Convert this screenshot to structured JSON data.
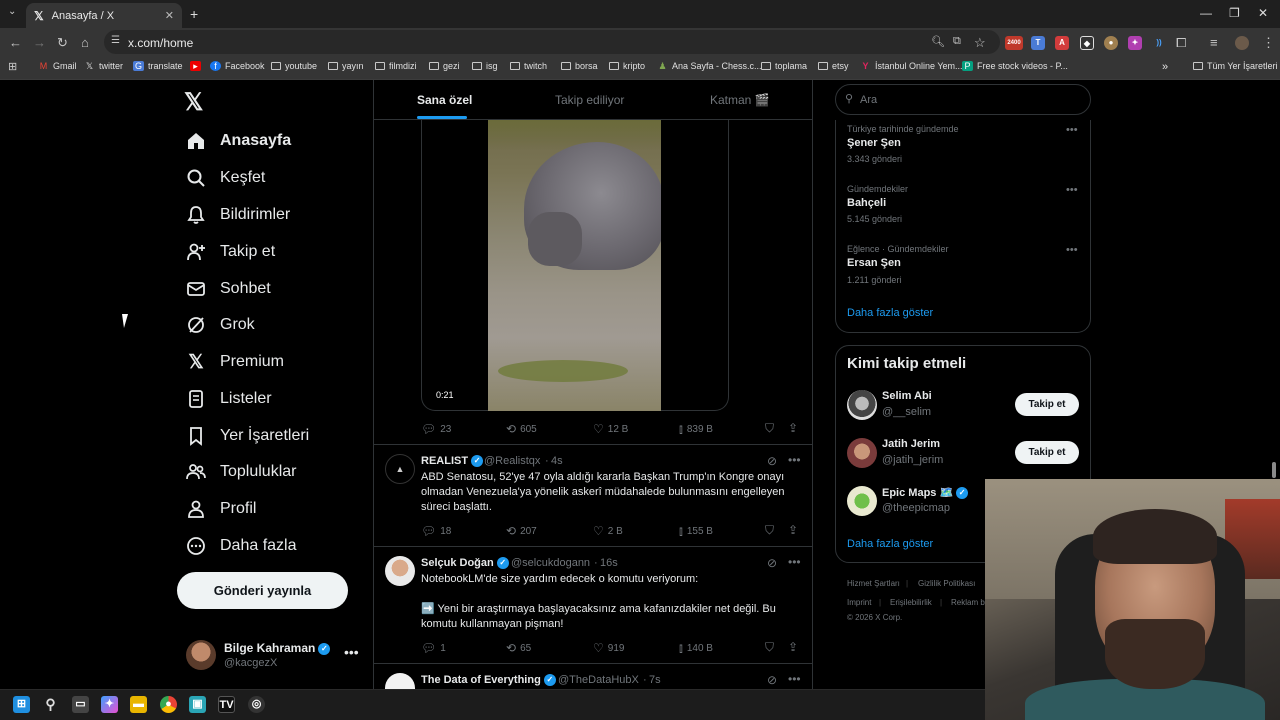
{
  "browser": {
    "tab_title": "Anasayfa / X",
    "url": "x.com/home",
    "bookmarks": [
      "Gmail",
      "twitter",
      "translate",
      "Facebook",
      "youtube",
      "yayın",
      "filmdizi",
      "gezi",
      "isg",
      "twitch",
      "borsa",
      "kripto",
      "Ana Sayfa - Chess.c...",
      "toplama",
      "etsy",
      "İstanbul Online Yem...",
      "Free stock videos - P...",
      "Tüm Yer İşaretleri"
    ],
    "ext_badge": "2400"
  },
  "nav": {
    "items": [
      "Anasayfa",
      "Keşfet",
      "Bildirimler",
      "Takip et",
      "Sohbet",
      "Grok",
      "Premium",
      "Listeler",
      "Yer İşaretleri",
      "Topluluklar",
      "Profil",
      "Daha fazla"
    ],
    "post_button": "Gönderi yayınla",
    "profile": {
      "name": "Bilge Kahraman",
      "handle": "@kacgezX"
    }
  },
  "timeline": {
    "tabs": [
      "Sana özel",
      "Takip ediliyor",
      "Katman 🎬"
    ],
    "video_tweet": {
      "duration": "0:21",
      "replies": "23",
      "reposts": "605",
      "likes": "12 B",
      "views": "839 B"
    },
    "tweets": [
      {
        "name": "REALIST",
        "handle": "@Realistqx",
        "time": "4s",
        "text": "ABD Senatosu, 52'ye 47 oyla aldığı kararla Başkan Trump'ın Kongre onayı olmadan Venezuela'ya yönelik askerî müdahalede bulunmasını engelleyen süreci başlattı.",
        "replies": "18",
        "reposts": "207",
        "likes": "2 B",
        "views": "155 B"
      },
      {
        "name": "Selçuk Doğan",
        "handle": "@selcukdogann",
        "time": "16s",
        "text1": "NotebookLM'de size yardım edecek o komutu veriyorum:",
        "text2": "➡️ Yeni bir araştırmaya başlayacaksınız ama kafanızdakiler net değil. Bu komutu kullanmayan pişman!",
        "replies": "1",
        "reposts": "65",
        "likes": "919",
        "views": "140 B"
      },
      {
        "name": "The Data of Everything",
        "handle": "@TheDataHubX",
        "time": "7s"
      }
    ]
  },
  "sidebar": {
    "search_placeholder": "Ara",
    "trends": [
      {
        "category": "Türkiye tarihinde gündemde",
        "name": "Şener Şen",
        "count": "3.343 gönderi"
      },
      {
        "category": "Gündemdekiler",
        "name": "Bahçeli",
        "count": "5.145 gönderi"
      },
      {
        "category": "Eğlence · Gündemdekiler",
        "name": "Ersan Şen",
        "count": "1.211 gönderi"
      }
    ],
    "show_more": "Daha fazla göster",
    "who_to_follow_title": "Kimi takip etmeli",
    "follow_button": "Takip et",
    "suggestions": [
      {
        "name": "Selim Abi",
        "handle": "@__selim"
      },
      {
        "name": "Jatih Jerim",
        "handle": "@jatih_jerim"
      },
      {
        "name": "Epic Maps 🗺️",
        "handle": "@theepicmap"
      }
    ],
    "footer": [
      "Hizmet Şartları",
      "Gizlilik Politikası",
      "Imprint",
      "Erişilebilirlik",
      "Reklam b",
      "© 2026 X Corp."
    ]
  },
  "colors": {
    "accent": "#1d9bf0",
    "background": "#000000",
    "border": "#2f3336"
  }
}
